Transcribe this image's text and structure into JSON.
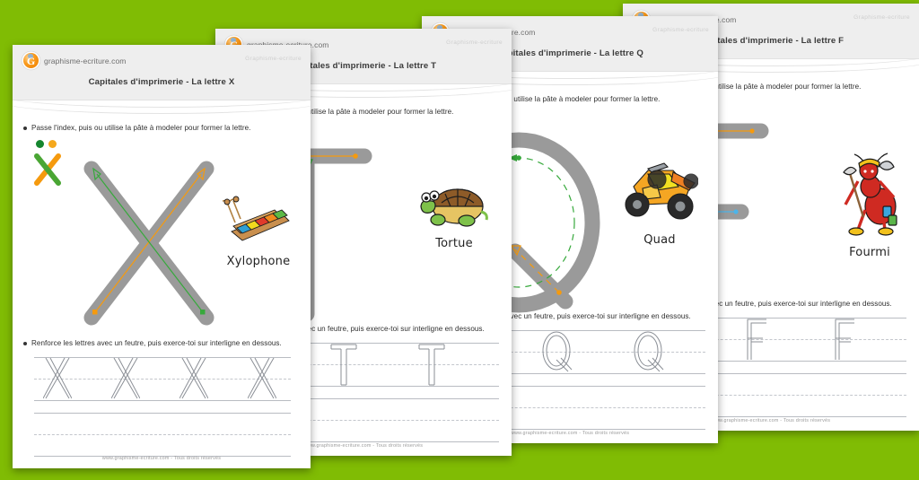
{
  "background_color": "#80bc04",
  "brand": {
    "name": "graphisme-ecriture.com",
    "logo_icon": "g-globe-logo-icon"
  },
  "watermark": "Graphisme-ecriture",
  "footer": "www.graphisme-ecriture.com - Tous droits réservés",
  "instructions": {
    "top": "Passe l'index, puis ou utilise la pâte à modeler pour former la lettre.",
    "bottom": "Renforce les lettres avec un feutre, puis exerce-toi sur interligne en dessous."
  },
  "colors": {
    "stroke_guide": "#9a9a9a",
    "arrow_orange": "#f59a0e",
    "arrow_green": "#37a93c",
    "arrow_blue": "#4db4e8",
    "rule_solid": "#b9bcc2",
    "rule_dash": "#c3c6cc",
    "header_bg": "#eeeeee",
    "title_text": "#3a3a3a"
  },
  "sheets": [
    {
      "id": "sheet-x",
      "letter": "X",
      "title": "Capitales d'imprimerie - La lettre X",
      "word": "Xylophone",
      "word_icon": "xylophone-image",
      "practice_count": 4,
      "strokes": [
        {
          "color": "#f59a0e",
          "order": 1,
          "desc": "bas-gauche vers haut-droite"
        },
        {
          "color": "#37a93c",
          "order": 2,
          "desc": "bas-droite vers haut-gauche"
        }
      ]
    },
    {
      "id": "sheet-t",
      "letter": "T",
      "title": "Capitales d'imprimerie - La lettre T",
      "word": "Tortue",
      "word_icon": "turtle-image",
      "practice_count": 3,
      "strokes": [
        {
          "color": "#f59a0e",
          "order": 1,
          "desc": "barre horizontale, droite vers gauche"
        },
        {
          "color": "#37a93c",
          "order": 2,
          "desc": "hampe verticale, bas vers haut"
        }
      ]
    },
    {
      "id": "sheet-q",
      "letter": "Q",
      "title": "Capitales d'imprimerie - La lettre Q",
      "word": "Quad",
      "word_icon": "quad-bike-image",
      "practice_count": 3,
      "strokes": [
        {
          "color": "#37a93c",
          "order": 1,
          "desc": "cercle, sens anti-horaire"
        },
        {
          "color": "#f59a0e",
          "order": 2,
          "desc": "queue oblique"
        }
      ]
    },
    {
      "id": "sheet-f",
      "letter": "F",
      "title": "Capitales d'imprimerie - La lettre F",
      "word": "Fourmi",
      "word_icon": "ant-image",
      "practice_count": 3,
      "strokes": [
        {
          "color": "#37a93c",
          "order": 1,
          "desc": "hampe verticale, bas vers haut"
        },
        {
          "color": "#f59a0e",
          "order": 2,
          "desc": "barre haute, droite vers gauche"
        },
        {
          "color": "#4db4e8",
          "order": 3,
          "desc": "barre médiane, droite vers gauche"
        }
      ]
    }
  ]
}
